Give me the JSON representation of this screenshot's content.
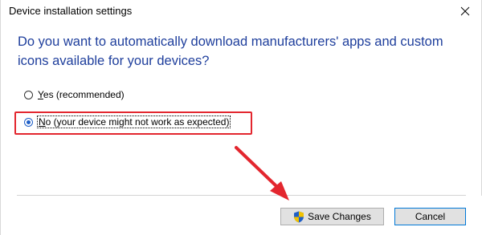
{
  "window": {
    "title": "Device installation settings"
  },
  "question": "Do you want to automatically download manufacturers' apps and custom icons available for your devices?",
  "options": [
    {
      "label_accel": "Y",
      "label_rest": "es (recommended)",
      "selected": false
    },
    {
      "label_accel": "N",
      "label_rest": "o (your device might not work as expected)",
      "selected": true
    }
  ],
  "buttons": {
    "save_label": "Save Changes",
    "cancel_label": "Cancel"
  },
  "icons": {
    "close": "close-icon",
    "shield": "uac-shield-icon",
    "annotation_arrow": "red-arrow-icon"
  },
  "colors": {
    "question_text": "#1e3e9c",
    "highlight": "#e3262e",
    "radio_selected": "#1f5fc7"
  }
}
